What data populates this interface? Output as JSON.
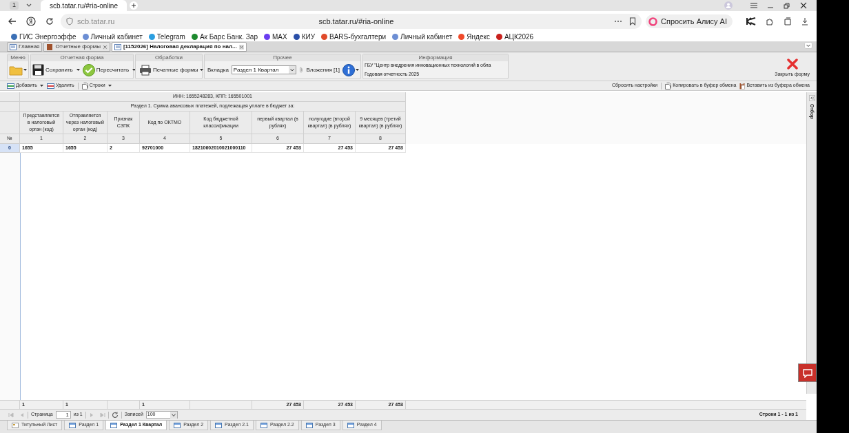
{
  "browser": {
    "tab_counter": "1",
    "tab_title": "scb.tatar.ru/#ria-online",
    "address": "scb.tatar.ru",
    "page_url": "scb.tatar.ru/#ria-online",
    "assistant_button": "Спросить Алису AI",
    "bookmarks": [
      "ГИС Энергоэффе",
      "Личный кабинет",
      "Telegram",
      "Ак Барс Банк. Зар",
      "MAX",
      "КИУ",
      "BARS-бухгалтери",
      "Личный кабинет",
      "Яндекс",
      "АЦК2026"
    ]
  },
  "app_tabs": [
    {
      "label": "Главная",
      "selected": false,
      "closable": false
    },
    {
      "label": "Отчетные формы",
      "selected": false,
      "closable": true
    },
    {
      "label": "[1152026] Налоговая декларация по нал...",
      "selected": true,
      "closable": true
    }
  ],
  "ribbon": {
    "menu_title": "Меню",
    "form_title": "Отчетная форма",
    "save": "Сохранить",
    "recalc": "Пересчитать",
    "processing_title": "Обработки",
    "print": "Печатные формы",
    "other_title": "Прочее",
    "tab_label": "Вкладка",
    "tab_value": "Раздел 1 Квартал",
    "attachments": "Вложения [1]",
    "info_title": "Информация",
    "info_lines": [
      "ГБУ \"Центр внедрения инновационных технологий в обла",
      "Годовая отчетность 2025"
    ],
    "close": "Закрыть форму"
  },
  "toolbar": {
    "add": "Добавить",
    "delete": "Удалить",
    "rows": "Строки",
    "reset": "Сбросить настройки",
    "copy": "Копировать в буфер обмена",
    "paste": "Вставить из буфера обмена"
  },
  "table": {
    "title": "ИНН: 1655248283, КПП: 165501001",
    "section": "Раздел 1. Сумма авансовых платежей, подлежащая уплате в бюджет за:",
    "number_header": "№",
    "columns": [
      {
        "title": "Представляется в налоговый орган (код)",
        "number": "1",
        "kind": "code"
      },
      {
        "title": "Отправляется через налоговый орган (код)",
        "number": "2",
        "kind": "code"
      },
      {
        "title": "Признак СЗПК",
        "number": "3",
        "kind": "code"
      },
      {
        "title": "Код по ОКТМО",
        "number": "4",
        "kind": "code"
      },
      {
        "title": "Код бюджетной классификации",
        "number": "5",
        "kind": "code"
      },
      {
        "title": "первый квартал (в рублях)",
        "number": "6",
        "kind": "amount"
      },
      {
        "title": "полугодие (второй квартал) (в рублях)",
        "number": "7",
        "kind": "amount"
      },
      {
        "title": "9 месяцев (третий квартал) (в рублях)",
        "number": "8",
        "kind": "amount"
      }
    ],
    "rows": [
      {
        "index": "0",
        "selected": true,
        "cells": [
          "1655",
          "1655",
          "2",
          "92701000",
          "18210602010021000110",
          "27 453",
          "27 453",
          "27 453"
        ]
      }
    ],
    "totals": {
      "column_1": "1",
      "column_2": "1",
      "column_4": "1",
      "column_6": "27 453",
      "column_7": "27 453",
      "column_8": "27 453"
    }
  },
  "side_panel": {
    "title": "Отбор"
  },
  "pager": {
    "page_label": "Страница",
    "page": "1",
    "of": "из 1",
    "records_label": "Записей",
    "records": "100",
    "summary": "Строки 1 - 1 из 1"
  },
  "sheet_tabs": [
    {
      "label": "Титульный Лист",
      "selected": false,
      "kind": "title"
    },
    {
      "label": "Раздел 1",
      "selected": false,
      "kind": "grid"
    },
    {
      "label": "Раздел 1 Квартал",
      "selected": true,
      "kind": "grid"
    },
    {
      "label": "Раздел 2",
      "selected": false,
      "kind": "grid"
    },
    {
      "label": "Раздел 2.1",
      "selected": false,
      "kind": "grid"
    },
    {
      "label": "Раздел 2.2",
      "selected": false,
      "kind": "grid"
    },
    {
      "label": "Раздел 3",
      "selected": false,
      "kind": "grid"
    },
    {
      "label": "Раздел 4",
      "selected": false,
      "kind": "grid"
    }
  ]
}
